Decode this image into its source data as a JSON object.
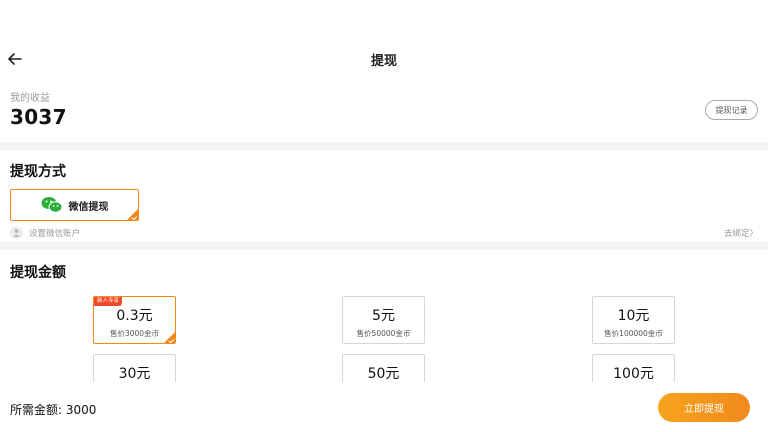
{
  "header": {
    "title": "提现",
    "back_icon": "arrow-left-icon"
  },
  "earnings": {
    "label": "我的收益",
    "value": "3037",
    "record_button": "提现记录"
  },
  "withdraw_method": {
    "title": "提现方式",
    "option_label": "微信提现",
    "option_icon": "wechat-icon",
    "bind_hint": "设置微信账户",
    "bind_link": "去绑定〉",
    "accent": "#f08a1c"
  },
  "withdraw_amount": {
    "title": "提现金额",
    "options": [
      {
        "value": "0.3元",
        "price": "售价3000金币",
        "tag": "新人专享",
        "selected": true
      },
      {
        "value": "5元",
        "price": "售价50000金币"
      },
      {
        "value": "10元",
        "price": "售价100000金币"
      },
      {
        "value": "30元"
      },
      {
        "value": "50元"
      },
      {
        "value": "100元"
      }
    ]
  },
  "footer": {
    "need_label": "所需金额: 3000",
    "submit_label": "立即提现"
  }
}
